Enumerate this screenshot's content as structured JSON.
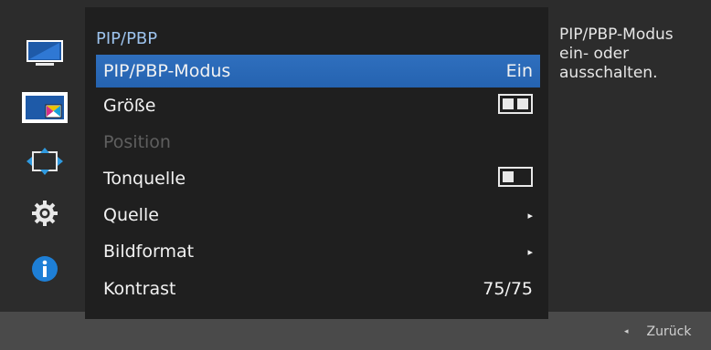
{
  "menu": {
    "title": "PIP/PBP",
    "items": [
      {
        "label": "PIP/PBP-Modus",
        "value": "Ein"
      },
      {
        "label": "Größe",
        "value": ""
      },
      {
        "label": "Position",
        "value": ""
      },
      {
        "label": "Tonquelle",
        "value": ""
      },
      {
        "label": "Quelle",
        "value": "▸"
      },
      {
        "label": "Bildformat",
        "value": "▸"
      },
      {
        "label": "Kontrast",
        "value": "75/75"
      }
    ]
  },
  "sidebar": {
    "icons": [
      "monitor-icon",
      "pip-icon",
      "move-icon",
      "gear-icon",
      "info-icon"
    ]
  },
  "description": "PIP/PBP-Modus ein- oder ausschalten.",
  "footer": {
    "back_label": "Zurück",
    "back_arrow": "◂"
  },
  "colors": {
    "accent": "#2a68b6",
    "background": "#2c2c2c",
    "panel": "#1f1f1f",
    "title": "#9cc2ec"
  }
}
